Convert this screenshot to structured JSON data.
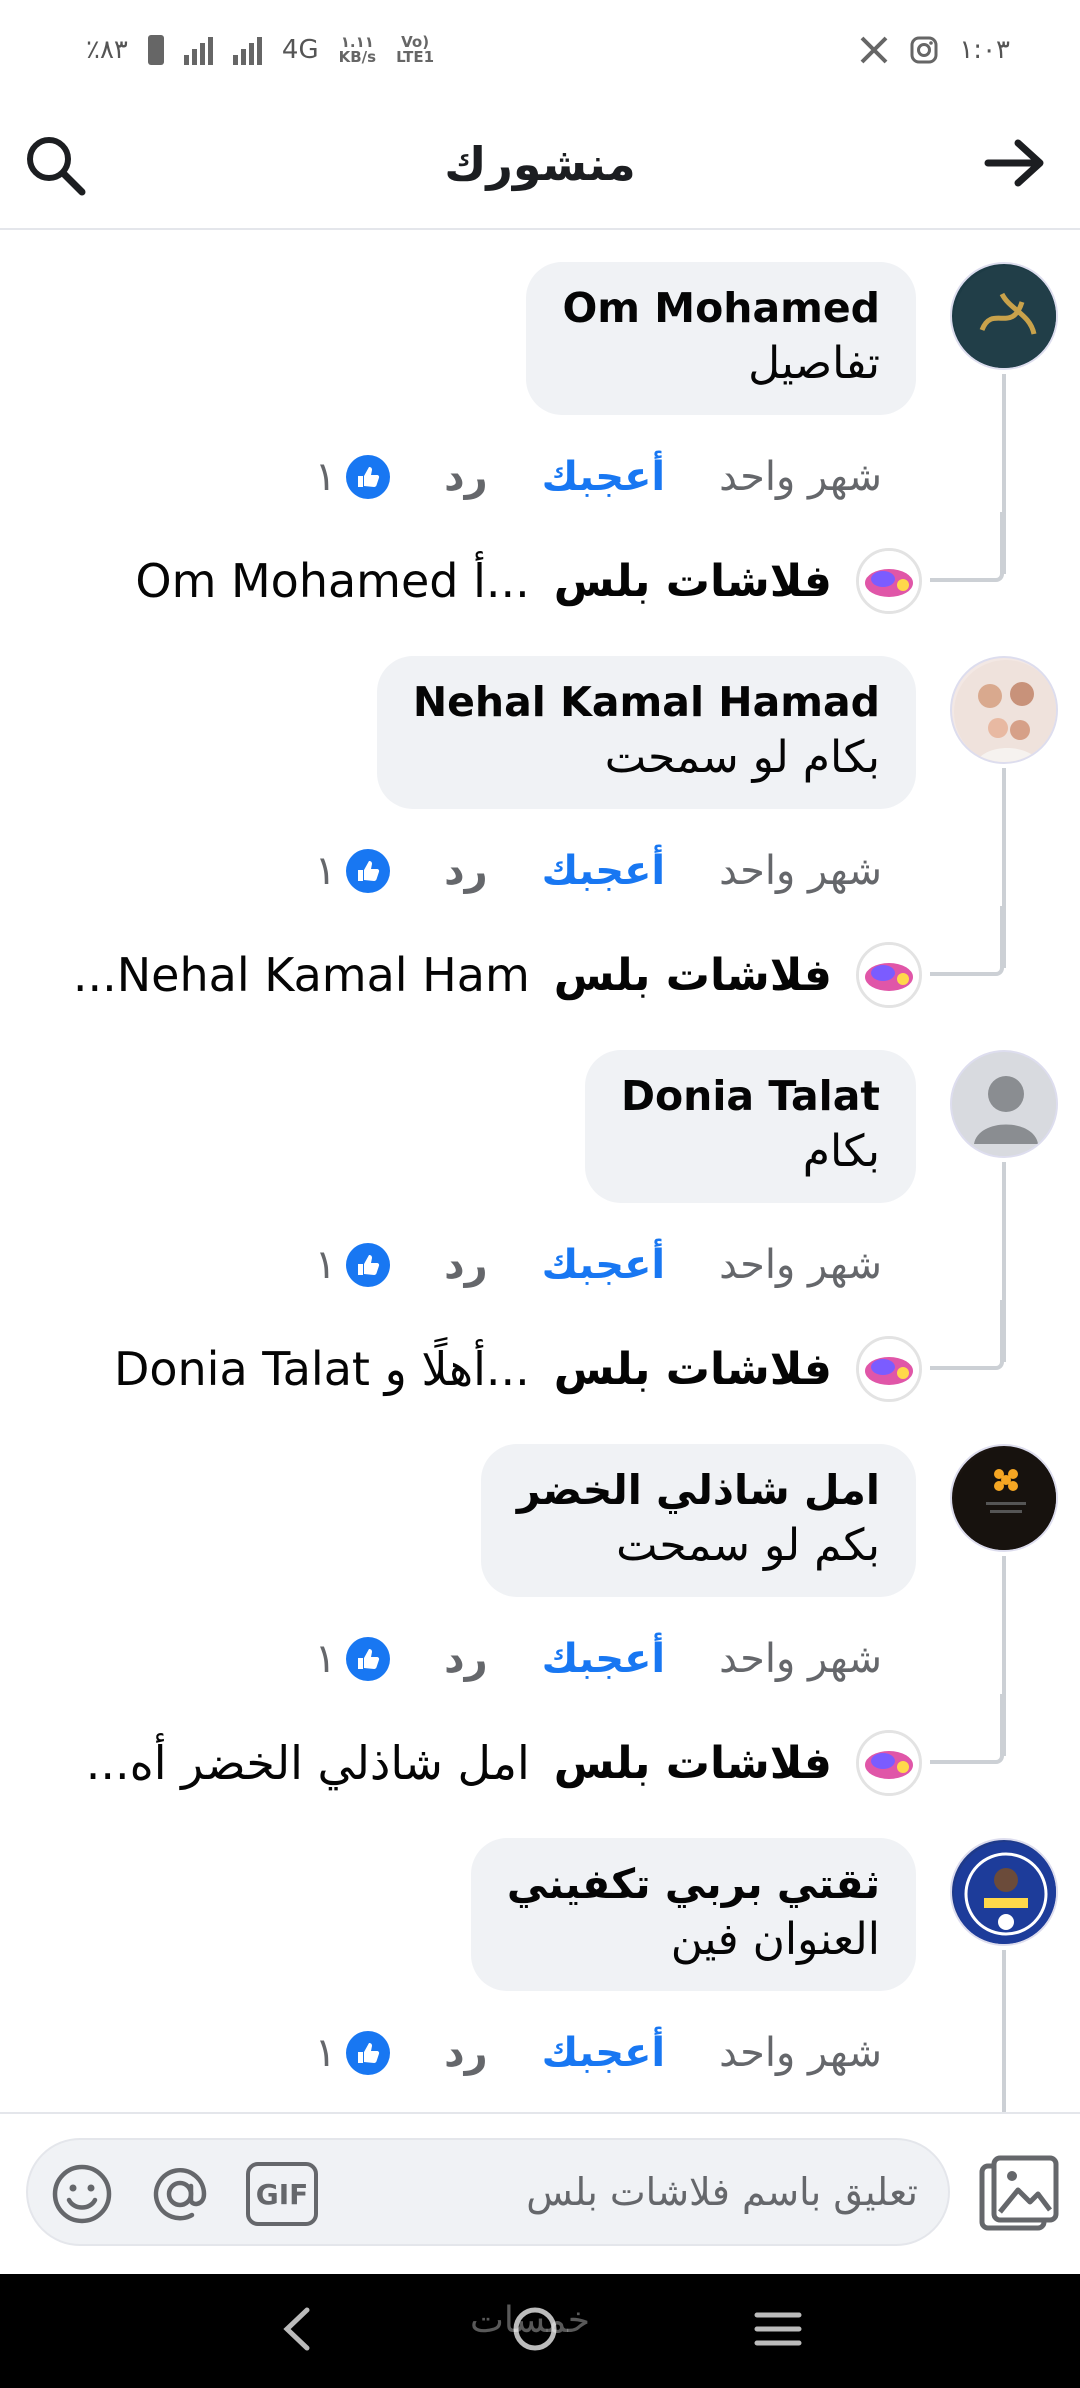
{
  "status_bar": {
    "battery": "٪٨٣",
    "network": "4G",
    "speed_value": "١.١١",
    "speed_unit": "KB/s",
    "volte_top": "Vo)",
    "volte_bottom": "LTE1",
    "time": "١:٠٣"
  },
  "header": {
    "title": "منشورك",
    "back_icon": "arrow-right-icon",
    "search_icon": "search-icon"
  },
  "comments": [
    {
      "author": "Om Mohamed",
      "text": "تفاصيل",
      "time": "شهر واحد",
      "like_label": "أعجبك",
      "reply_label": "رد",
      "reactions": "١",
      "reply_author": "فلاشات بلس",
      "reply_text": "...أ      Om Mohamed"
    },
    {
      "author": "Nehal Kamal Hamad",
      "text": "بكام لو سمحت",
      "time": "شهر واحد",
      "like_label": "أعجبك",
      "reply_label": "رد",
      "reactions": "١",
      "reply_author": "فلاشات بلس",
      "reply_text": "Nehal Kamal Ham..."
    },
    {
      "author": "Donia Talat",
      "text": "بكام",
      "time": "شهر واحد",
      "like_label": "أعجبك",
      "reply_label": "رد",
      "reactions": "١",
      "reply_author": "فلاشات بلس",
      "reply_text": "...أهلًا و    Donia Talat"
    },
    {
      "author": "امل شاذلي الخضر",
      "text": "بكم لو سمحت",
      "time": "شهر واحد",
      "like_label": "أعجبك",
      "reply_label": "رد",
      "reactions": "١",
      "reply_author": "فلاشات بلس",
      "reply_text": "امل شاذلي الخضر  أه..."
    },
    {
      "author": "ثقتي بربي تكفيني",
      "text": "العنوان فين",
      "time": "شهر واحد",
      "like_label": "أعجبك",
      "reply_label": "رد",
      "reactions": "١",
      "reply_author": "",
      "reply_text": ""
    }
  ],
  "composer": {
    "placeholder": "تعليق باسم فلاشات بلس",
    "gif_label": "GIF"
  },
  "watermark": "خمسات",
  "colors": {
    "accent": "#1877f2",
    "bubble": "#f0f2f5",
    "muted": "#65676b"
  }
}
